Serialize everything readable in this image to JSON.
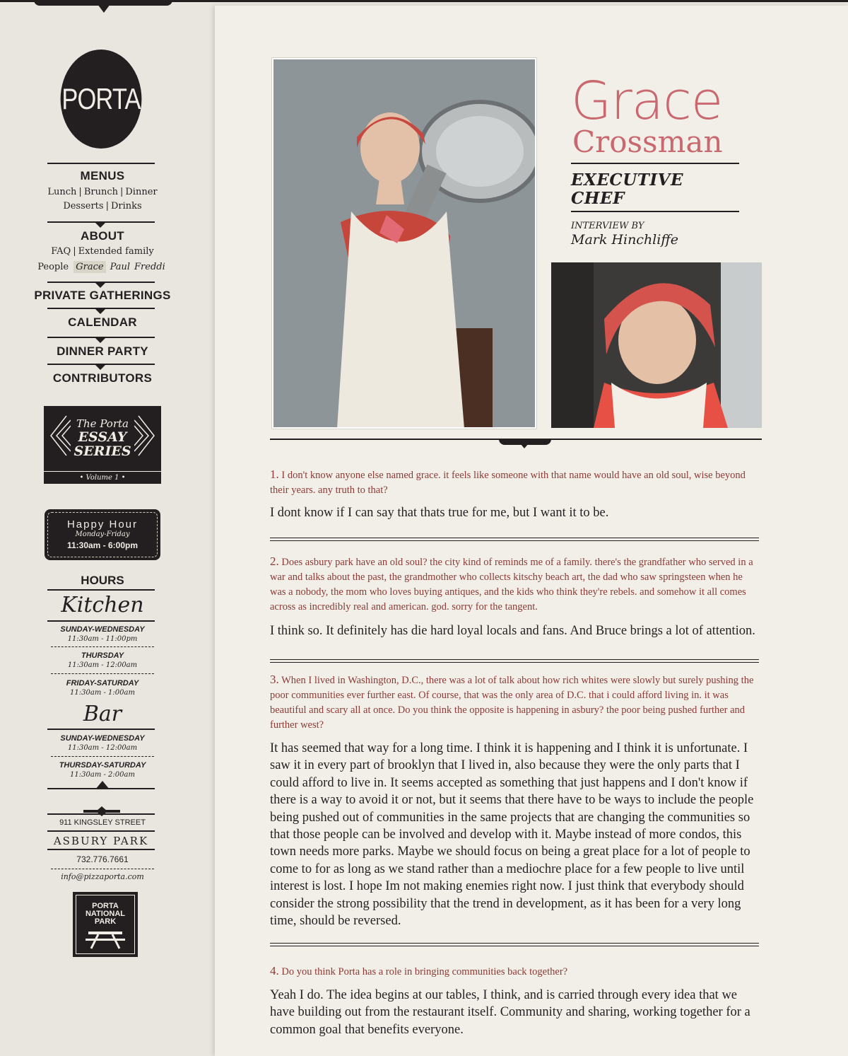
{
  "logo": "PORTA",
  "nav": {
    "menus": {
      "title": "MENUS",
      "row1": [
        "Lunch",
        "Brunch",
        "Dinner"
      ],
      "row2": [
        "Desserts",
        "Drinks"
      ]
    },
    "about": {
      "title": "ABOUT",
      "row1": [
        "FAQ",
        "Extended family"
      ],
      "people": "People",
      "people_sub": [
        "Grace",
        "Paul",
        "Freddi"
      ]
    },
    "private": "PRIVATE GATHERINGS",
    "calendar": "CALENDAR",
    "dinner": "DINNER PARTY",
    "contributors": "CONTRIBUTORS"
  },
  "essay": {
    "line1": "The Porta",
    "line2": "ESSAY",
    "line3": "SERIES",
    "volume": "• Volume 1 •"
  },
  "happy_hour": {
    "title": "Happy Hour",
    "days": "Monday-Friday",
    "time": "11:30am - 6:00pm"
  },
  "hours": {
    "title": "HOURS",
    "kitchen": {
      "title": "Kitchen",
      "rows": [
        {
          "day": "SUNDAY-WEDNESDAY",
          "time": "11:30am - 11:00pm"
        },
        {
          "day": "THURSDAY",
          "time": "11:30am - 12:00am"
        },
        {
          "day": "FRIDAY-SATURDAY",
          "time": "11:30am - 1:00am"
        }
      ]
    },
    "bar": {
      "title": "Bar",
      "rows": [
        {
          "day": "SUNDAY-WEDNESDAY",
          "time": "11:30am - 12:00am"
        },
        {
          "day": "THURSDAY-SATURDAY",
          "time": "11:30am - 2:00am"
        }
      ]
    }
  },
  "address": {
    "street": "911 KINGSLEY STREET",
    "city": "ASBURY PARK",
    "phone": "732.776.7661",
    "email": "info@pizzaporta.com"
  },
  "park_badge": {
    "line1": "PORTA",
    "line2": "NATIONAL",
    "line3": "PARK"
  },
  "profile": {
    "first": "Grace",
    "last": "Crossman",
    "role_line1": "EXECUTIVE",
    "role_line2": "CHEF",
    "interview_by": "INTERVIEW BY",
    "interviewer": "Mark Hinchliffe"
  },
  "qa": [
    {
      "num": "1.",
      "q": "I don't know anyone else named grace. it feels like someone with that name would have an old soul, wise beyond their years. any truth to that?",
      "a": "I dont know if I can say that thats true for me, but I want it to be."
    },
    {
      "num": "2.",
      "q": "Does asbury park have an old soul? the city kind of reminds me of a family. there's the grandfather who served in a war and talks about the past, the grandmother who collects kitschy beach art, the dad who saw springsteen when he was a nobody, the mom who loves buying antiques, and the kids who think they're rebels. and somehow it all comes across as incredibly real and american. god. sorry for the tangent.",
      "a": "I think so. It definitely has die hard loyal locals and fans. And Bruce brings a lot of attention."
    },
    {
      "num": "3.",
      "q": "When I lived in Washington, D.C., there was a lot of talk about how rich whites were slowly but surely pushing the poor communities ever further east. Of course, that was the only area of D.C. that i could afford living in. it was beautiful and scary all at once. Do you think the opposite is happening in asbury? the poor being pushed further and further west?",
      "a": "It has seemed that way for a long time. I think it is happening and I think it is unfortunate. I saw it in every part of brooklyn that I lived in, also because they were the only parts that I could afford to live in. It seems accepted as something that just happens and I don't know if there is a way to avoid it or not, but it seems that there have to be ways to include the people being pushed out of communities in the same projects that are changing the communities so that those people can be involved and develop with it. Maybe instead of more condos, this town needs more parks. Maybe we should focus on being a great place for a lot of people to come to for as long as we stand rather than a mediochre place for a few people to live until interest is lost. I hope Im not making enemies right now. I just think that everybody should consider the strong possibility that the trend in development, as it has been for a very long time, should be reversed."
    },
    {
      "num": "4.",
      "q": "Do you think Porta has a role in bringing communities back together?",
      "a": "Yeah I do. The idea begins at our tables, I think, and is carried through every idea that we have building out from the restaurant itself. Community and sharing, working together for a common goal that benefits everyone."
    }
  ]
}
